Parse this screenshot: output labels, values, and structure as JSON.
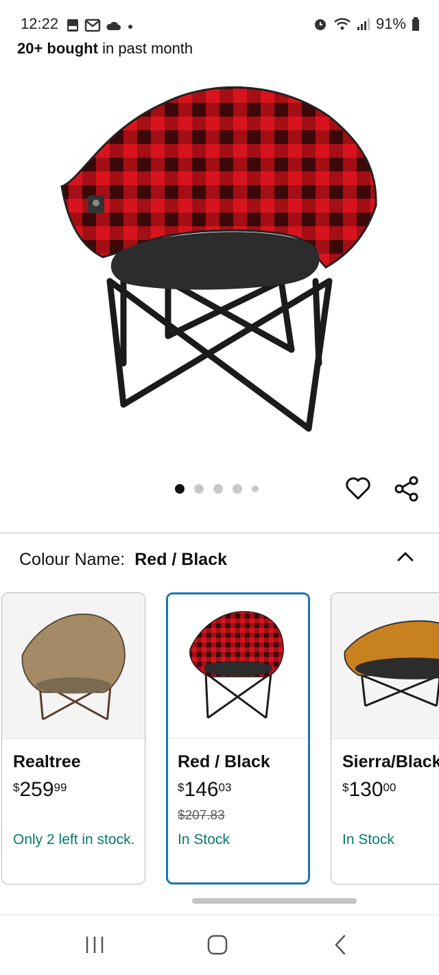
{
  "status_bar": {
    "time": "12:22",
    "battery": "91%"
  },
  "social_proof": {
    "bold": "20+ bought",
    "rest": "in past month"
  },
  "gallery": {
    "image_count": 5,
    "active_index": 0
  },
  "variant": {
    "label": "Colour Name:",
    "selected": "Red / Black"
  },
  "options": [
    {
      "name": "Realtree",
      "currency": "$",
      "price_whole": "259",
      "price_cents": "99",
      "was": "",
      "stock": "Only 2 left in stock.",
      "selected": false
    },
    {
      "name": "Red / Black",
      "currency": "$",
      "price_whole": "146",
      "price_cents": "03",
      "was": "$207.83",
      "stock": "In Stock",
      "selected": true
    },
    {
      "name": "Sierra/Black",
      "currency": "$",
      "price_whole": "130",
      "price_cents": "00",
      "was": "",
      "stock": "In Stock",
      "selected": false
    }
  ],
  "colors": {
    "accent": "#1a73b8",
    "stock_green": "#067d62",
    "plaid_red": "#d7141d",
    "sierra_orange": "#c8811f"
  }
}
